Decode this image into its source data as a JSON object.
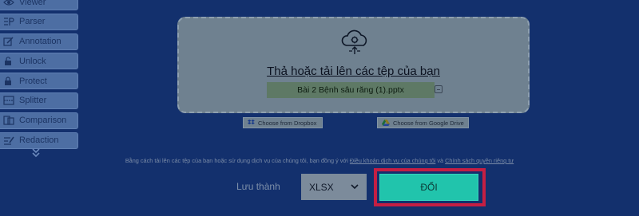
{
  "sidebar": {
    "items": [
      {
        "label": "Viewer",
        "icon": "eye-icon"
      },
      {
        "label": "Parser",
        "icon": "parser-icon"
      },
      {
        "label": "Annotation",
        "icon": "annotation-icon"
      },
      {
        "label": "Unlock",
        "icon": "unlock-icon"
      },
      {
        "label": "Protect",
        "icon": "lock-icon"
      },
      {
        "label": "Splitter",
        "icon": "splitter-icon"
      },
      {
        "label": "Comparison",
        "icon": "comparison-icon"
      },
      {
        "label": "Redaction",
        "icon": "redaction-icon"
      }
    ],
    "more_icon": "double-chevron-down-icon"
  },
  "upload": {
    "title": "Thả hoặc tải lên các tệp của bạn",
    "file_name": "Bài 2 Bệnh sâu răng (1).pptx",
    "dropbox_label": "Choose from Dropbox",
    "gdrive_label": "Choose from Google Drive"
  },
  "terms": {
    "prefix": "Bằng cách tải lên các tệp của bạn hoặc sử dụng dịch vụ của chúng tôi, bạn đồng ý với",
    "terms_link": "Điều khoản dịch vụ của chúng tôi",
    "and": "và",
    "privacy_link": "Chính sách quyền riêng tư"
  },
  "convert": {
    "save_as_label": "Lưu thành",
    "format_value": "XLSX",
    "button_label": "ĐỔI"
  },
  "colors": {
    "background": "#13306d",
    "accent": "#21c4ac",
    "highlight": "#c51f43"
  }
}
